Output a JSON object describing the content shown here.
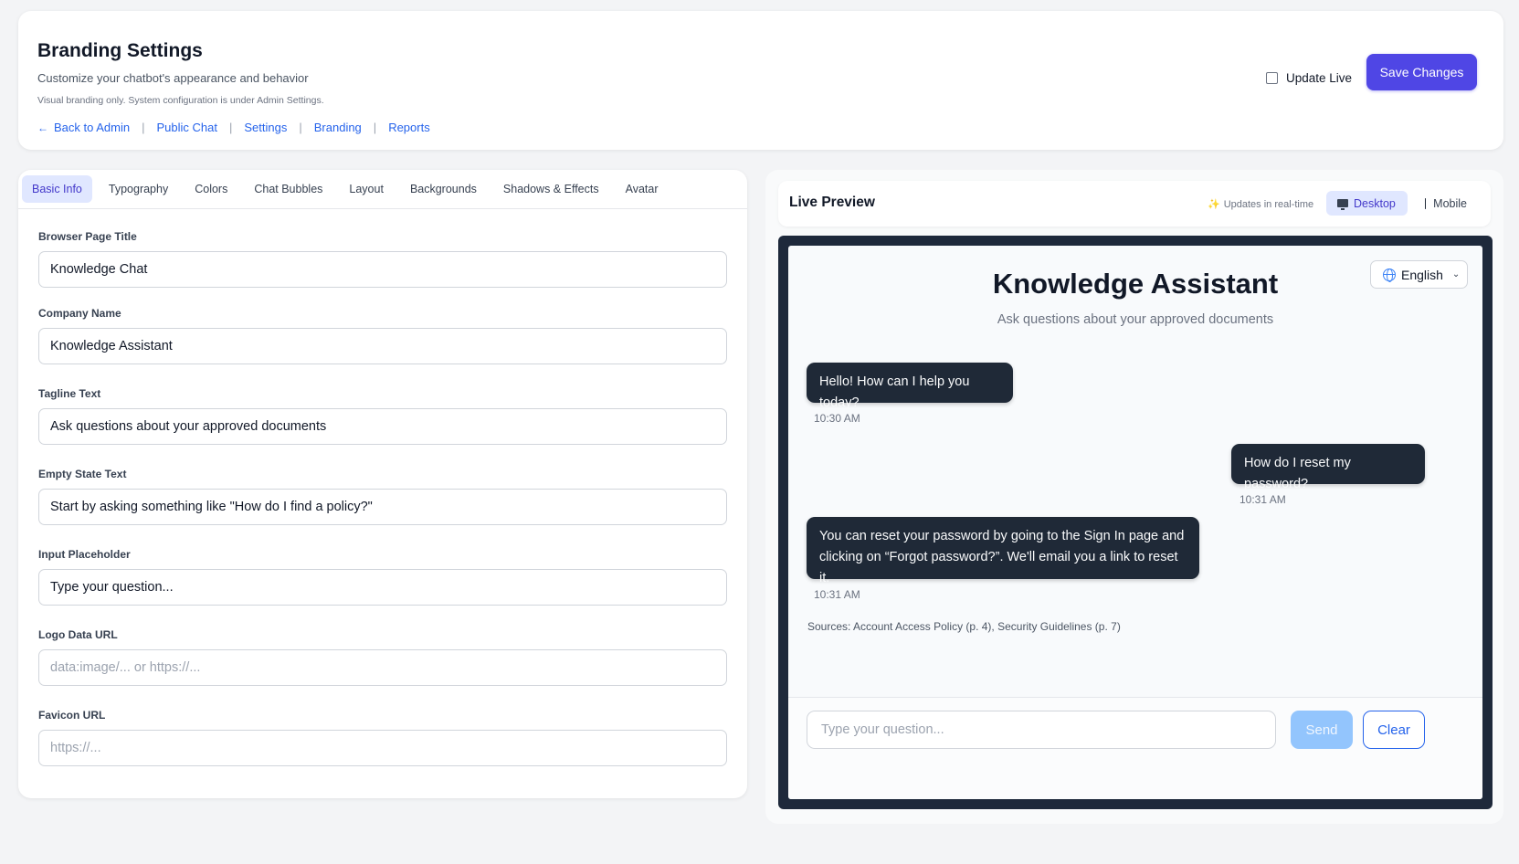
{
  "header": {
    "title": "Branding Settings",
    "subtitle": "Customize your chatbot's appearance and behavior",
    "note": "Visual branding only. System configuration is under Admin Settings.",
    "links": [
      {
        "label": "Back to Admin",
        "icon": "arrow-left-icon"
      },
      {
        "label": "Public Chat"
      },
      {
        "label": "Settings"
      },
      {
        "label": "Branding"
      },
      {
        "label": "Reports"
      }
    ],
    "update_live_label": "Update Live",
    "update_live_checked": false,
    "save_label": "Save Changes",
    "accent_color": "#4f46e5"
  },
  "tabs": [
    "Basic Info",
    "Typography",
    "Colors",
    "Chat Bubbles",
    "Layout",
    "Backgrounds",
    "Shadows & Effects",
    "Avatar"
  ],
  "active_tab": "Basic Info",
  "fields": [
    {
      "label": "Browser Page Title",
      "value": "Knowledge Chat",
      "placeholder": ""
    },
    {
      "label": "Company Name",
      "value": "Knowledge Assistant",
      "placeholder": ""
    },
    {
      "label": "Tagline Text",
      "value": "Ask questions about your approved documents",
      "placeholder": ""
    },
    {
      "label": "Empty State Text",
      "value": "Start by asking something like \"How do I find a policy?\"",
      "placeholder": ""
    },
    {
      "label": "Input Placeholder",
      "value": "Type your question...",
      "placeholder": ""
    },
    {
      "label": "Logo Data URL",
      "value": "",
      "placeholder": "data:image/... or https://..."
    },
    {
      "label": "Favicon URL",
      "value": "",
      "placeholder": "https://..."
    }
  ],
  "preview": {
    "title": "Live Preview",
    "status": "Updates in real-time",
    "status_icon": "sparkle-icon",
    "desktop_label": "Desktop",
    "mobile_label": "Mobile",
    "active_device": "Desktop",
    "chat": {
      "title": "Knowledge Assistant",
      "tagline": "Ask questions about your approved documents",
      "language": "English",
      "messages": [
        {
          "role": "assistant",
          "text": "Hello! How can I help you today?",
          "time": "10:30 AM"
        },
        {
          "role": "user",
          "text": "How do I reset my password?",
          "time": "10:31 AM"
        },
        {
          "role": "assistant",
          "text": "You can reset your password by going to the Sign In page and clicking on “Forgot password?”. We'll email you a link to reset it.",
          "time": "10:31 AM"
        }
      ],
      "sources": "Sources: Account Access Policy (p. 4), Security Guidelines (p. 7)",
      "input_placeholder": "Type your question...",
      "send_label": "Send",
      "clear_label": "Clear",
      "bubble_color": "#1f2937",
      "frame_color": "#1e293b"
    }
  }
}
